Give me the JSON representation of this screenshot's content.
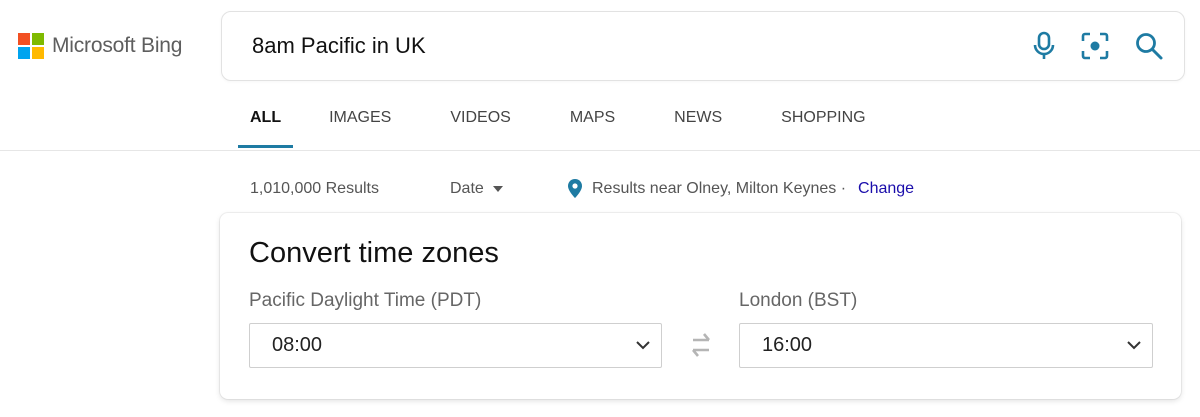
{
  "brand": {
    "name": "Microsoft Bing",
    "logo_colors": [
      "#f25022",
      "#7fba00",
      "#00a4ef",
      "#ffb900"
    ]
  },
  "search": {
    "query": "8am Pacific in UK",
    "mic_icon": "microphone-icon",
    "visual_icon": "visual-search-icon",
    "search_icon": "search-icon"
  },
  "tabs": [
    {
      "label": "ALL",
      "active": true
    },
    {
      "label": "IMAGES"
    },
    {
      "label": "VIDEOS"
    },
    {
      "label": "MAPS"
    },
    {
      "label": "NEWS"
    },
    {
      "label": "SHOPPING"
    }
  ],
  "results_bar": {
    "count": "1,010,000 Results",
    "date_filter": "Date",
    "location_text": "Results near Olney, Milton Keynes ·",
    "change_link": "Change"
  },
  "converter": {
    "title": "Convert time zones",
    "from_label": "Pacific Daylight Time (PDT)",
    "from_value": "08:00",
    "to_label": "London (BST)",
    "to_value": "16:00",
    "swap_icon": "swap-arrows-icon"
  },
  "colors": {
    "accent": "#1e7ba3",
    "link": "#1a0dab",
    "icon": "#1e7ba3"
  }
}
